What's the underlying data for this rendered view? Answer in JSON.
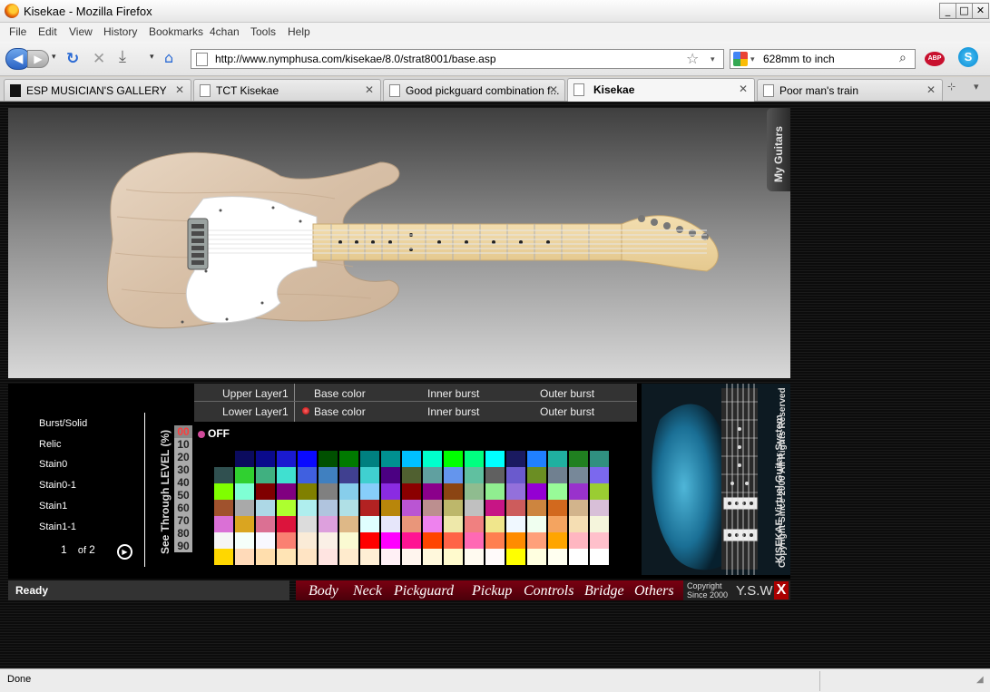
{
  "window": {
    "title": "Kisekae - Mozilla Firefox"
  },
  "menubar": {
    "items": [
      "File",
      "Edit",
      "View",
      "History",
      "Bookmarks",
      "4chan",
      "Tools",
      "Help"
    ]
  },
  "navbar": {
    "url": "http://www.nymphusa.com/kisekae/8.0/strat8001/base.asp",
    "search": "628mm to inch"
  },
  "tabs": [
    {
      "label": "ESP MUSICIAN'S GALLERY"
    },
    {
      "label": "TCT Kisekae"
    },
    {
      "label": "Good pickguard combination f..."
    },
    {
      "label": "Kisekae",
      "active": true
    },
    {
      "label": "Poor man's train"
    }
  ],
  "page": {
    "my_guitars": "My Guitars",
    "finishes": [
      "Burst/Solid",
      "Relic",
      "Stain0",
      "Stain0-1",
      "Stain1",
      "Stain1-1"
    ],
    "pagination": {
      "current": "1",
      "of": "of",
      "total": "2"
    },
    "level_label": "See Through LEVEL (%)",
    "levels": [
      "00",
      "10",
      "20",
      "30",
      "40",
      "50",
      "60",
      "70",
      "80",
      "90"
    ],
    "off_label": "OFF",
    "layers": {
      "upper": {
        "name": "Upper Layer1",
        "base": "Base color",
        "inner": "Inner burst",
        "outer": "Outer burst"
      },
      "lower": {
        "name": "Lower Layer1",
        "base": "Base color",
        "inner": "Inner burst",
        "outer": "Outer burst"
      }
    },
    "thumb": {
      "title": "KISEKAE Virtual Guitar System",
      "copyright": "Copyright Since 2000 All Rights Reserved"
    },
    "status": "Ready",
    "parts": [
      "Body",
      "Neck",
      "Pickguard",
      "Pickup",
      "Controls",
      "Bridge",
      "Others"
    ],
    "brand": {
      "copyright": "Copyright",
      "since": "Since 2000",
      "name": "Y.S.W",
      "close": "X"
    },
    "palette_colors": [
      [
        "#000000",
        "#0b0b5e",
        "#0a0a8c",
        "#1a1ad0",
        "#0a0aff",
        "#005000",
        "#007a00",
        "#008080",
        "#009090",
        "#00c0ff",
        "#00ffcc",
        "#00ff00",
        "#00ff80",
        "#00ffff",
        "#1a1a60",
        "#2080ff",
        "#20b0a0",
        "#208020",
        "#309080"
      ],
      [
        "#305050",
        "#30d030",
        "#40b080",
        "#40e0d0",
        "#4060e0",
        "#4080c0",
        "#404090",
        "#40d0d0",
        "#4b0082",
        "#506030",
        "#60a0a0",
        "#6495ed",
        "#60c0a0",
        "#606060",
        "#6a5acd",
        "#6b8e23",
        "#708090",
        "#778899",
        "#7b68ee"
      ],
      [
        "#7fff00",
        "#7fffd4",
        "#800000",
        "#800080",
        "#808000",
        "#808080",
        "#87ceeb",
        "#87cefa",
        "#8a2be2",
        "#8b0000",
        "#8b008b",
        "#8b4513",
        "#8fbc8f",
        "#90ee90",
        "#9370db",
        "#9400d3",
        "#98fb98",
        "#9932cc",
        "#9acd32"
      ],
      [
        "#a0522d",
        "#a9a9a9",
        "#add8e6",
        "#adff2f",
        "#afeeee",
        "#b0c4de",
        "#b0e0e6",
        "#b22222",
        "#b8860b",
        "#ba55d3",
        "#bc8f8f",
        "#bdb76b",
        "#c0c0c0",
        "#c71585",
        "#cd5c5c",
        "#cd853f",
        "#d2691e",
        "#d2b48c",
        "#d8bfd8"
      ],
      [
        "#da70d6",
        "#daa520",
        "#db7093",
        "#dc143c",
        "#dcdcdc",
        "#dda0dd",
        "#deb887",
        "#e0ffff",
        "#e6e6fa",
        "#e9967a",
        "#ee82ee",
        "#eee8aa",
        "#f08080",
        "#f0e68c",
        "#f0f8ff",
        "#f0fff0",
        "#f4a460",
        "#f5deb3",
        "#f5f5dc"
      ],
      [
        "#f5f5f5",
        "#f5fffa",
        "#f8f8ff",
        "#fa8072",
        "#faebd7",
        "#faf0e6",
        "#fafad2",
        "#ff0000",
        "#ff00ff",
        "#ff1493",
        "#ff4500",
        "#ff6347",
        "#ff69b4",
        "#ff7f50",
        "#ff8c00",
        "#ffa07a",
        "#ffa500",
        "#ffb6c1",
        "#ffc0cb"
      ],
      [
        "#ffd700",
        "#ffdab9",
        "#ffdead",
        "#ffe4b5",
        "#ffe4c4",
        "#ffe4e1",
        "#ffebcd",
        "#ffefd5",
        "#fff0f5",
        "#fff5ee",
        "#fff8dc",
        "#fffacd",
        "#fffaf0",
        "#fffafa",
        "#ffff00",
        "#ffffe0",
        "#fffff0",
        "#ffffff",
        "#ffffff"
      ]
    ]
  },
  "statusbar": {
    "text": "Done"
  }
}
